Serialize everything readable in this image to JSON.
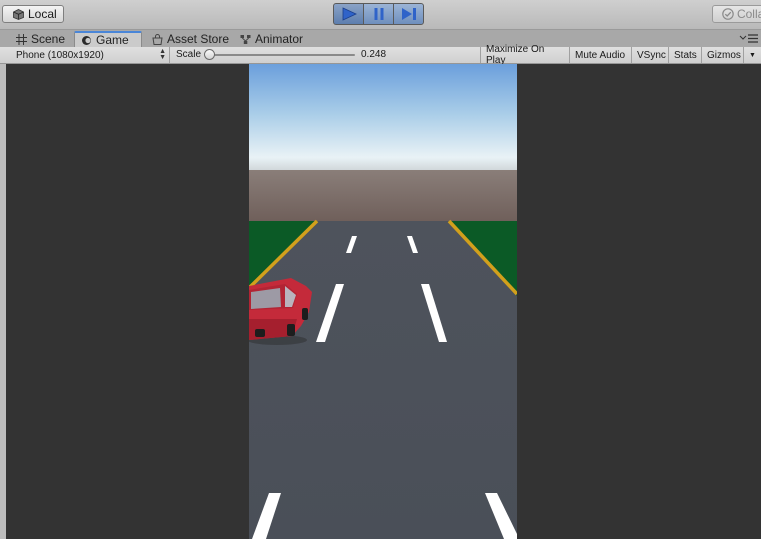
{
  "toolbar": {
    "local_label": "Local",
    "collab_label": "Collab",
    "play_icon": "play-icon",
    "pause_icon": "pause-icon",
    "step_icon": "step-icon"
  },
  "tabs": [
    {
      "label": "Scene",
      "icon": "scene-grid-icon"
    },
    {
      "label": "Game",
      "icon": "game-icon",
      "active": true
    },
    {
      "label": "Asset Store",
      "icon": "asset-store-icon"
    },
    {
      "label": "Animator",
      "icon": "animator-icon"
    }
  ],
  "game_bar": {
    "resolution": "Phone (1080x1920)",
    "scale_label": "Scale",
    "scale_value": "0.248",
    "scale_fraction": 0.0,
    "maximize_on_play": "Maximize On Play",
    "mute_audio": "Mute Audio",
    "vsync": "VSync",
    "stats": "Stats",
    "gizmos": "Gizmos"
  },
  "colors": {
    "accent_tab": "#4a86d8",
    "play_active": "#2f63c9",
    "viewport_bg": "#333333",
    "sky_top": "#6b9fdc",
    "sky_horizon": "#e9f2f6",
    "ground_far": "#766762",
    "grass": "#0b5a26",
    "road": "#4b5059",
    "road_edge": "#d2a01c",
    "lane_marking": "#ffffff",
    "car_body": "#c42a3a"
  }
}
